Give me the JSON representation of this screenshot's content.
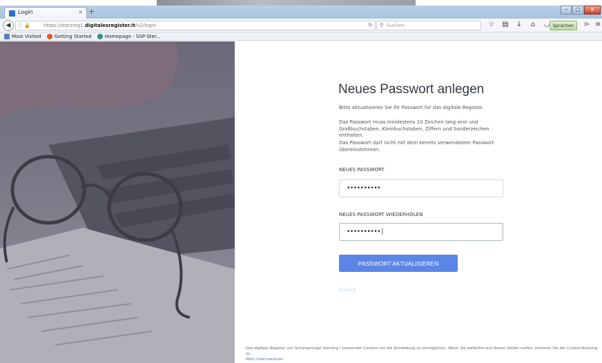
{
  "browser": {
    "tab_title": "Login",
    "tab_close": "×",
    "new_tab": "+",
    "url_prefix": "https://sterzing1.",
    "url_domain": "digitalesregister.it",
    "url_path": "/v2/login",
    "search_placeholder": "Suchen",
    "language_button": "Sprachen",
    "window_buttons": [
      "–",
      "□",
      "x"
    ]
  },
  "bookmarks": [
    {
      "label": "Most Visited",
      "color": "#5a7fbf"
    },
    {
      "label": "Getting Started",
      "color": "#e2572b"
    },
    {
      "label": "Homepage - SSP-Ster...",
      "color": "#3a8f7a"
    }
  ],
  "form": {
    "title": "Neues Passwort anlegen",
    "intro": "Bitte aktualisieren Sie Ihr Passwort für das digitale Register.",
    "rule_length": "Das Passwort muss mindestens 10 Zeichen lang sein und Großbuchstaben, Kleinbuchstaben, Ziffern und Sonderzeichen enthalten.",
    "rule_reuse": "Das Passwort darf nicht mit dem bereits verwendetem Passwort übereinstimmen.",
    "new_password_label": "NEUES PASSWORT",
    "new_password_value": "••••••••••",
    "repeat_password_label": "NEUES PASSWORT WIEDERHOLEN",
    "repeat_password_value": "••••••••••|",
    "submit_label": "PASSWORT AKTUALISIEREN",
    "back_label": "Zurück"
  },
  "cookie_notice": {
    "text": "Das digitale Register von Schulsprengel Sterzing I verwendet Cookies um die Anmeldung zu ermöglichen. Wenn Sie weiterhin auf diesen Seiten surfen, stimmen Sie der Cookie-Nutzung zu.",
    "link": "Mehr Informationen"
  },
  "colors": {
    "accent": "#5b86e5",
    "photo_overlay": "#6d6879"
  }
}
